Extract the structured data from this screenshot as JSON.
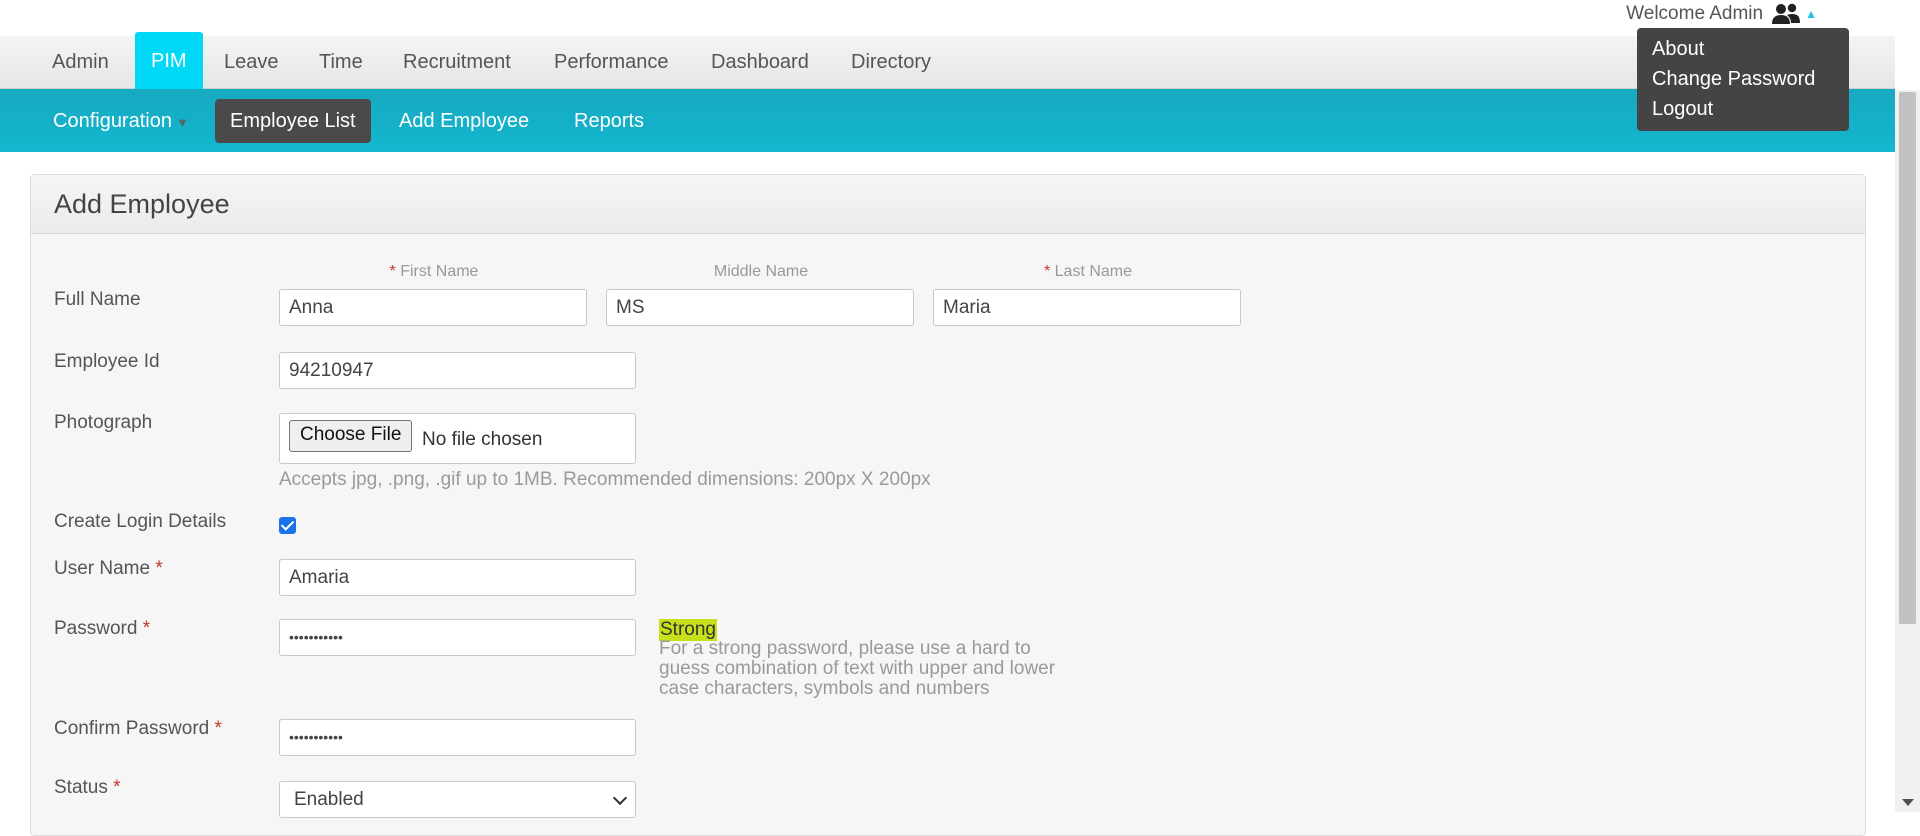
{
  "header": {
    "welcome_text": "Welcome Admin",
    "user_icon": "users-icon",
    "dropdown": {
      "items": [
        {
          "label": "About"
        },
        {
          "label": "Change Password"
        },
        {
          "label": "Logout"
        }
      ]
    }
  },
  "main_nav": {
    "items": [
      {
        "label": "Admin"
      },
      {
        "label": "PIM"
      },
      {
        "label": "Leave"
      },
      {
        "label": "Time"
      },
      {
        "label": "Recruitment"
      },
      {
        "label": "Performance"
      },
      {
        "label": "Dashboard"
      },
      {
        "label": "Directory"
      }
    ],
    "active": "PIM"
  },
  "sub_nav": {
    "items": [
      {
        "label": "Configuration"
      },
      {
        "label": "Employee List"
      },
      {
        "label": "Add Employee"
      },
      {
        "label": "Reports"
      }
    ],
    "active": "Employee List"
  },
  "form": {
    "title": "Add Employee",
    "full_name_label": "Full Name",
    "first_name_label": "First Name",
    "middle_name_label": "Middle Name",
    "last_name_label": "Last Name",
    "required_marker": "*",
    "first_name_value": "Anna",
    "middle_name_value": "MS",
    "last_name_value": "Maria",
    "employee_id_label": "Employee Id",
    "employee_id_value": "94210947",
    "photograph_label": "Photograph",
    "choose_file_label": "Choose File",
    "no_file_text": "No file chosen",
    "photo_hint": "Accepts jpg, .png, .gif up to 1MB. Recommended dimensions: 200px X 200px",
    "create_login_label": "Create Login Details",
    "create_login_checked": true,
    "user_name_label": "User Name",
    "user_name_value": "Amaria",
    "password_label": "Password",
    "password_value": "•••••••••••",
    "password_strength": "Strong",
    "password_hint": "For a strong password, please use a hard to guess combination of text with upper and lower case characters, symbols and numbers",
    "confirm_password_label": "Confirm Password",
    "confirm_password_value": "•••••••••••",
    "status_label": "Status",
    "status_value": "Enabled"
  },
  "colors": {
    "primary": "#13b7cf",
    "active_tab": "#00d9f5",
    "dark": "#444444",
    "strength": "#c8e019"
  }
}
